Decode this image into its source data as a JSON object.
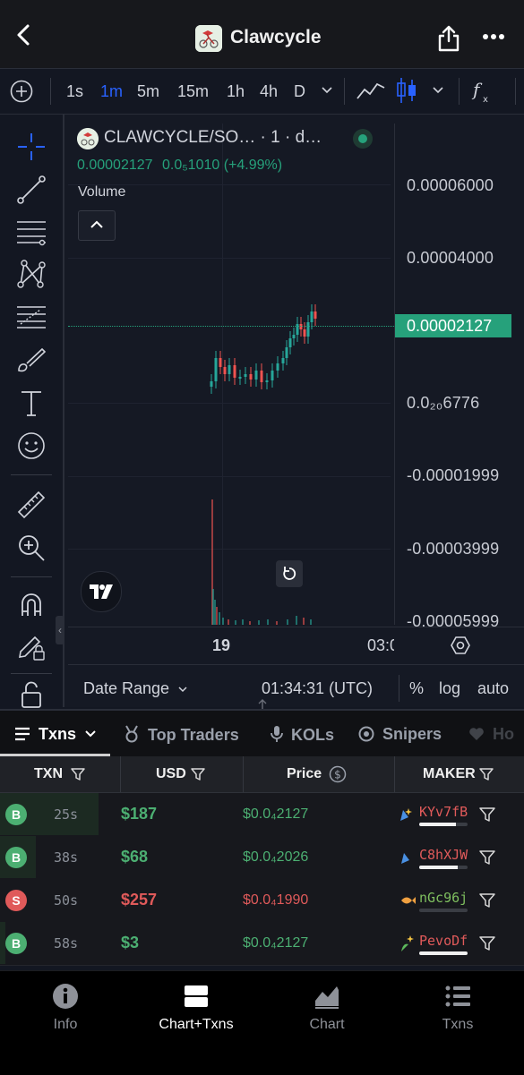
{
  "header": {
    "title": "Clawcycle",
    "back_icon": "chevron-left-icon",
    "share_icon": "share-icon",
    "more_icon": "ellipsis-icon"
  },
  "intervals": {
    "items": [
      "1s",
      "1m",
      "5m",
      "15m",
      "1h",
      "4h",
      "D"
    ],
    "active": "1m"
  },
  "chart": {
    "legend_title": "CLAWCYCLE/SO… · 1 · d…",
    "legend_price": "0.00002127",
    "legend_change": "0.0₅1010 (+4.99%)",
    "volume_label": "Volume",
    "y_labels": [
      "0.00006000",
      "0.00004000",
      "0.0₂₀6776",
      "-0.00001999",
      "-0.00003999",
      "-0.00005999"
    ],
    "last_price_tag": "0.00002127",
    "x_labels": [
      "19",
      "03:0"
    ],
    "date_range_label": "Date Range",
    "utc_time": "01:34:31 (UTC)",
    "pct_label": "%",
    "log_label": "log",
    "auto_label": "auto",
    "colors": {
      "up": "#26a69a",
      "down": "#ef5350",
      "accent": "#2962ff"
    }
  },
  "chart_data": {
    "type": "candlestick",
    "interval": "1m",
    "y_unit": "price",
    "last_price": 2.127e-05,
    "change": "0.0₅1010 (+4.99%)",
    "ylim": [
      -6e-05,
      7e-05
    ]
  },
  "tabs": {
    "items": [
      {
        "label": "Txns",
        "icon": "list-icon"
      },
      {
        "label": "Top Traders",
        "icon": "medal-icon"
      },
      {
        "label": "KOLs",
        "icon": "microphone-icon"
      },
      {
        "label": "Snipers",
        "icon": "target-icon"
      },
      {
        "label": "Ho",
        "icon": "heart-icon"
      }
    ],
    "active": "Txns"
  },
  "table": {
    "headers": {
      "txn": "TXN",
      "usd": "USD",
      "price": "Price",
      "maker": "MAKER"
    },
    "rows": [
      {
        "type": "B",
        "age": "25s",
        "usd": "$187",
        "price": "$0.0₄2127",
        "maker": "KYv7fB",
        "bar": 0.75
      },
      {
        "type": "B",
        "age": "38s",
        "usd": "$68",
        "price": "$0.0₄2026",
        "maker": "C8hXJW",
        "bar": 0.8
      },
      {
        "type": "S",
        "age": "50s",
        "usd": "$257",
        "price": "$0.0₄1990",
        "maker": "nGc96j",
        "bar": 0.0
      },
      {
        "type": "B",
        "age": "58s",
        "usd": "$3",
        "price": "$0.0₄2127",
        "maker": "PevoDf",
        "bar": 1.0
      }
    ],
    "colors": {
      "buy": "#4caf72",
      "sell": "#e05a5a",
      "maker_red": "#e05a5a",
      "maker_green": "#7fbf5f"
    }
  },
  "bottom_nav": {
    "items": [
      {
        "label": "Info",
        "icon": "info-icon"
      },
      {
        "label": "Chart+Txns",
        "icon": "split-view-icon"
      },
      {
        "label": "Chart",
        "icon": "area-chart-icon"
      },
      {
        "label": "Txns",
        "icon": "list-icon"
      }
    ],
    "active": "Chart+Txns"
  }
}
